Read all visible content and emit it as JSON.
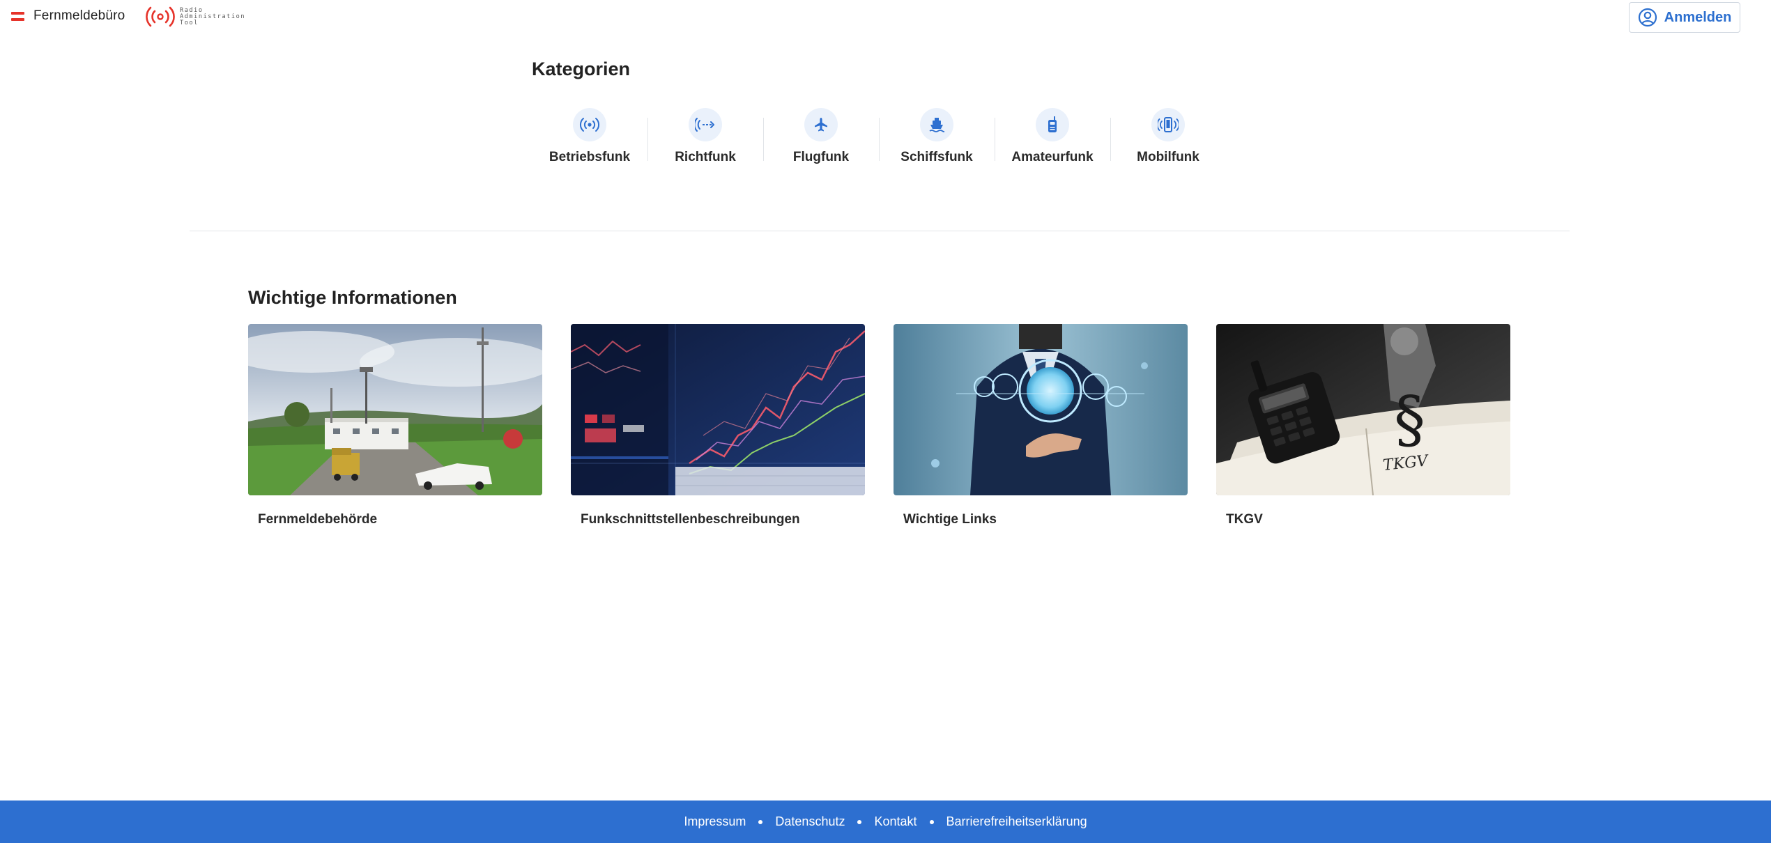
{
  "header": {
    "brand_name": "Fernmeldebüro",
    "logo_text": [
      "Radio",
      "Administration",
      "Tool"
    ],
    "login_label": "Anmelden"
  },
  "categories": {
    "title": "Kategorien",
    "items": [
      {
        "label": "Betriebsfunk",
        "icon": "radio-waves-icon"
      },
      {
        "label": "Richtfunk",
        "icon": "directional-radio-icon"
      },
      {
        "label": "Flugfunk",
        "icon": "airplane-icon"
      },
      {
        "label": "Schiffsfunk",
        "icon": "ship-icon"
      },
      {
        "label": "Amateurfunk",
        "icon": "walkie-talkie-icon"
      },
      {
        "label": "Mobilfunk",
        "icon": "mobile-phone-icon"
      }
    ]
  },
  "info": {
    "title": "Wichtige Informationen",
    "cards": [
      {
        "label": "Fernmeldebehörde",
        "image": "radio-station-photo"
      },
      {
        "label": "Funkschnittstellenbeschreibungen",
        "image": "data-chart-photo"
      },
      {
        "label": "Wichtige Links",
        "image": "business-network-photo"
      },
      {
        "label": "TKGV",
        "image": "law-book-radio-photo"
      }
    ]
  },
  "footer": {
    "links": [
      "Impressum",
      "Datenschutz",
      "Kontakt",
      "Barrierefreiheitserklärung"
    ]
  },
  "colors": {
    "accent": "#2d6fd0",
    "brand_red": "#e6332a",
    "icon_bg": "#eaf1fb"
  }
}
